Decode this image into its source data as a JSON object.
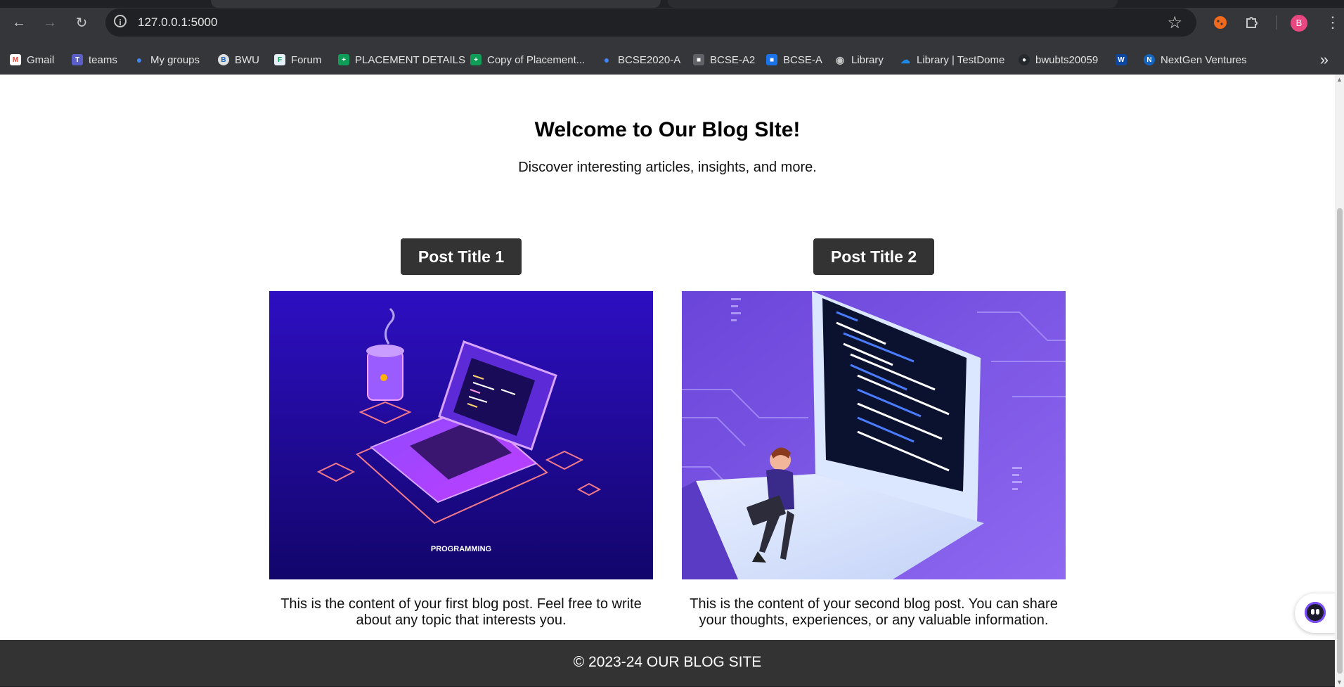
{
  "browser": {
    "url": "127.0.0.1:5000",
    "avatar_letter": "B",
    "bookmarks": [
      {
        "label": "Gmail",
        "icon": "gmail-icon",
        "color": "#ea4335"
      },
      {
        "label": "teams",
        "icon": "teams-icon",
        "color": "#5b5fc7"
      },
      {
        "label": "My groups",
        "icon": "groups-icon",
        "color": "#4285f4"
      },
      {
        "label": "BWU",
        "icon": "bwu-icon",
        "color": "#e0e0e0"
      },
      {
        "label": "Forum",
        "icon": "forum-icon",
        "color": "#e6eef7"
      },
      {
        "label": "PLACEMENT DETAILS",
        "icon": "sheets-icon",
        "color": "#0f9d58"
      },
      {
        "label": "Copy of Placement...",
        "icon": "sheets-icon",
        "color": "#0f9d58"
      },
      {
        "label": "BCSE2020-A",
        "icon": "groups-icon",
        "color": "#4285f4"
      },
      {
        "label": "BCSE-A2",
        "icon": "classroom-icon",
        "color": "#5f6368"
      },
      {
        "label": "BCSE-A",
        "icon": "classroom-icon",
        "color": "#1a73e8"
      },
      {
        "label": "Library",
        "icon": "globe-icon",
        "color": "#9aa0a6"
      },
      {
        "label": "Library | TestDome",
        "icon": "cloud-icon",
        "color": "#1e88e5"
      },
      {
        "label": "bwubts20059",
        "icon": "github-icon",
        "color": "#24292e"
      },
      {
        "label": "",
        "icon": "w-icon",
        "color": "#0d47a1"
      },
      {
        "label": "NextGen Ventures",
        "icon": "nextgen-icon",
        "color": "#1565c0"
      }
    ]
  },
  "page": {
    "title": "Welcome to Our Blog SIte!",
    "subtitle": "Discover interesting articles, insights, and more.",
    "posts": [
      {
        "title": "Post Title 1",
        "image_caption": "PROGRAMMING",
        "excerpt": "This is the content of your first blog post. Feel free to write about any topic that interests you."
      },
      {
        "title": "Post Title 2",
        "excerpt": "This is the content of your second blog post. You can share your thoughts, experiences, or any valuable information."
      }
    ],
    "footer": "© 2023-24 OUR BLOG SITE"
  },
  "colors": {
    "button_bg": "#333333",
    "footer_bg": "#333333",
    "image1_bg": "#2a0fb0",
    "image2_bg": "#7a52e8"
  }
}
